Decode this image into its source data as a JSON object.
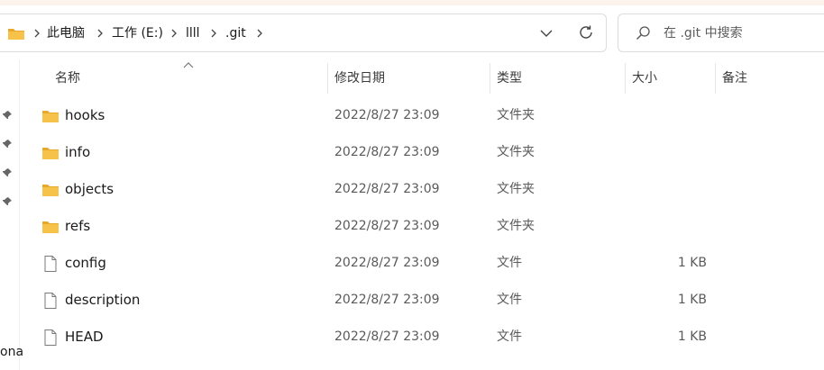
{
  "address": {
    "crumbs": [
      "此电脑",
      "工作 (E:)",
      "llll",
      ".git"
    ]
  },
  "search": {
    "placeholder": "在 .git 中搜索"
  },
  "columns": {
    "name": "名称",
    "date": "修改日期",
    "type": "类型",
    "size": "大小",
    "note": "备注"
  },
  "files": [
    {
      "name": "hooks",
      "date": "2022/8/27 23:09",
      "type": "文件夹",
      "size": "",
      "icon": "folder-icon"
    },
    {
      "name": "info",
      "date": "2022/8/27 23:09",
      "type": "文件夹",
      "size": "",
      "icon": "folder-icon"
    },
    {
      "name": "objects",
      "date": "2022/8/27 23:09",
      "type": "文件夹",
      "size": "",
      "icon": "folder-icon"
    },
    {
      "name": "refs",
      "date": "2022/8/27 23:09",
      "type": "文件夹",
      "size": "",
      "icon": "folder-icon"
    },
    {
      "name": "config",
      "date": "2022/8/27 23:09",
      "type": "文件",
      "size": "1 KB",
      "icon": "file-icon"
    },
    {
      "name": "description",
      "date": "2022/8/27 23:09",
      "type": "文件",
      "size": "1 KB",
      "icon": "file-icon"
    },
    {
      "name": "HEAD",
      "date": "2022/8/27 23:09",
      "type": "文件",
      "size": "1 KB",
      "icon": "file-icon"
    }
  ],
  "left_pane": {
    "cutoff_text": "ona"
  },
  "colors": {
    "folder": "#f6c24a",
    "folder_dark": "#e6a92a",
    "border": "#dcdcdc"
  }
}
